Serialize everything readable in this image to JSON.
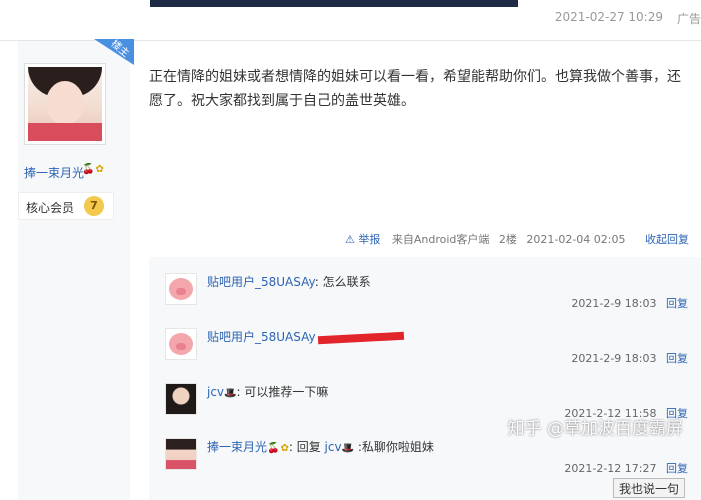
{
  "top": {
    "date": "2021-02-27 10:29",
    "ad": "广告"
  },
  "author": {
    "louzhu_badge": "楼主",
    "name": "捧一束月光",
    "member_label": "核心会员",
    "member_level": "7",
    "badges": [
      "cherry-icon",
      "flower-icon"
    ]
  },
  "post": {
    "text": "正在情降的姐妹或者想情降的姐妹可以看一看，希望能帮助你们。也算我做个善事，还愿了。祝大家都找到属于自己的盖世英雄。",
    "report": "举报",
    "source": "来自Android客户端",
    "floor": "2楼",
    "time": "2021-02-04 02:05",
    "collapse": "收起回复"
  },
  "replies": [
    {
      "name": "贴吧用户_58UASAy",
      "text": ": 怎么联系",
      "time": "2021-2-9 18:03",
      "reply_label": "回复",
      "avatar": "pig-avatar"
    },
    {
      "name": "贴吧用户_58UASAy",
      "text": "",
      "time": "2021-2-9 18:03",
      "reply_label": "回复",
      "avatar": "pig-avatar"
    },
    {
      "name": "jcv",
      "text": ": 可以推荐一下嘛",
      "time": "2021-2-12 11:58",
      "reply_label": "回复",
      "avatar": "dark-avatar"
    },
    {
      "name": "捧一束月光",
      "prefix": ": 回复 ",
      "target": "jcv",
      "text": " :私聊你啦姐妹",
      "time": "2021-2-12 17:27",
      "reply_label": "回复",
      "avatar": "girl-avatar"
    }
  ],
  "watermark": "知乎 @草加波百度霸屏",
  "say_button": "我也说一句",
  "colors": {
    "link": "#2d64b3",
    "louzhu": "#4a90e2",
    "redact": "#e1252b"
  }
}
